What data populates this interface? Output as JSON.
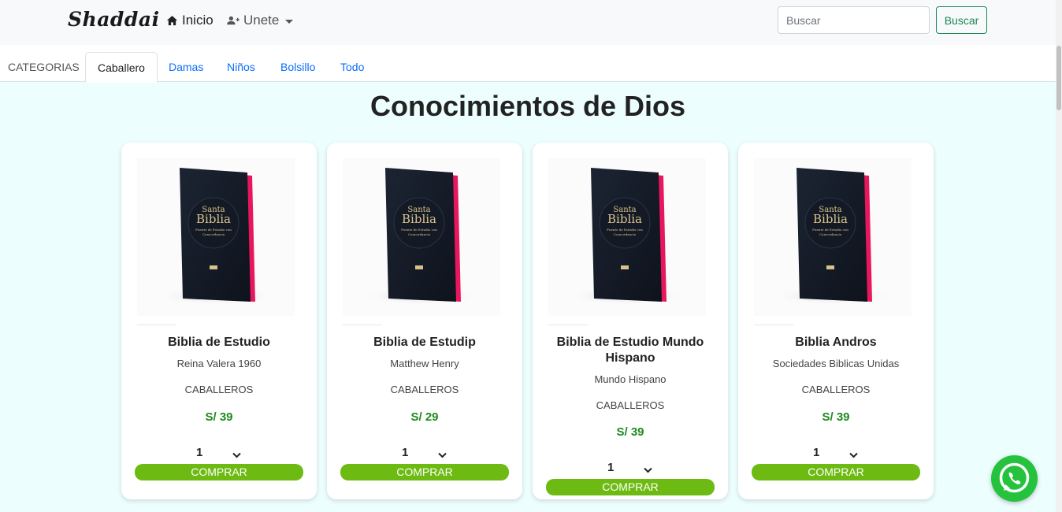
{
  "brand": "Shaddai",
  "nav": {
    "inicio_label": "Inicio",
    "unete_label": "Unete",
    "search_placeholder": "Buscar",
    "search_button": "Buscar"
  },
  "tabs": {
    "heading": "CATEGORIAS",
    "items": [
      "Caballero",
      "Damas",
      "Niños",
      "Bolsillo",
      "Todo"
    ],
    "active": "Caballero"
  },
  "page_title": "Conocimientos de Dios",
  "products": [
    {
      "title": "Biblia de Estudio",
      "author": "Reina Valera 1960",
      "category": "CABALLEROS",
      "price": "S/ 39",
      "qty": "1",
      "buy_label": "COMPRAR"
    },
    {
      "title": "Biblia de Estudip",
      "author": "Matthew Henry",
      "category": "CABALLEROS",
      "price": "S/ 29",
      "qty": "1",
      "buy_label": "COMPRAR"
    },
    {
      "title": "Biblia de Estudio Mundo Hispano",
      "author": "Mundo Hispano",
      "category": "CABALLEROS",
      "price": "S/ 39",
      "qty": "1",
      "buy_label": "COMPRAR"
    },
    {
      "title": "Biblia Andros",
      "author": "Sociedades Biblicas Unidas",
      "category": "CABALLEROS",
      "price": "S/ 39",
      "qty": "1",
      "buy_label": "COMPRAR"
    }
  ],
  "book_cover": {
    "line1": "Santa",
    "line2": "Biblia",
    "line3": "Fuente de Estudio con",
    "line4": "Concordancia"
  },
  "colors": {
    "page_bg": "#ecfefe",
    "accent_green": "#6dbb12",
    "price_green": "#1e8a1e",
    "link_blue": "#0d6efd",
    "whatsapp": "#25c23e"
  },
  "icons": [
    "home-icon",
    "user-plus-icon",
    "chevron-down-icon",
    "whatsapp-icon"
  ]
}
